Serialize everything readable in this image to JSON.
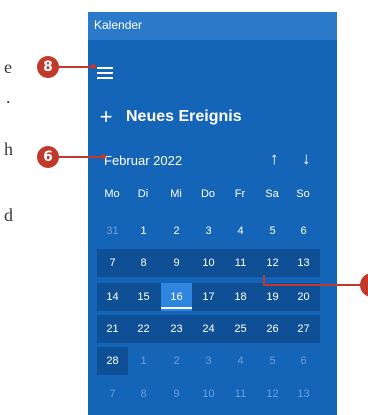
{
  "background_text": [
    "e",
    ".",
    "h",
    "d"
  ],
  "window": {
    "title": "Kalender"
  },
  "new_event": {
    "label": "Neues Ereignis"
  },
  "calendar": {
    "month": "Februar 2022",
    "weekdays": [
      "Mo",
      "Di",
      "Mi",
      "Do",
      "Fr",
      "Sa",
      "So"
    ],
    "weeks": [
      [
        {
          "d": "31",
          "m": true
        },
        {
          "d": "1"
        },
        {
          "d": "2"
        },
        {
          "d": "3"
        },
        {
          "d": "4"
        },
        {
          "d": "5"
        },
        {
          "d": "6"
        }
      ],
      [
        {
          "d": "7"
        },
        {
          "d": "8"
        },
        {
          "d": "9"
        },
        {
          "d": "10"
        },
        {
          "d": "11"
        },
        {
          "d": "12"
        },
        {
          "d": "13"
        }
      ],
      [
        {
          "d": "14"
        },
        {
          "d": "15"
        },
        {
          "d": "16",
          "today": true
        },
        {
          "d": "17"
        },
        {
          "d": "18"
        },
        {
          "d": "19"
        },
        {
          "d": "20"
        }
      ],
      [
        {
          "d": "21"
        },
        {
          "d": "22"
        },
        {
          "d": "23"
        },
        {
          "d": "24"
        },
        {
          "d": "25"
        },
        {
          "d": "26"
        },
        {
          "d": "27"
        }
      ],
      [
        {
          "d": "28"
        },
        {
          "d": "1",
          "m": true
        },
        {
          "d": "2",
          "m": true
        },
        {
          "d": "3",
          "m": true
        },
        {
          "d": "4",
          "m": true
        },
        {
          "d": "5",
          "m": true
        },
        {
          "d": "6",
          "m": true
        }
      ],
      [
        {
          "d": "7",
          "m": true
        },
        {
          "d": "8",
          "m": true
        },
        {
          "d": "9",
          "m": true
        },
        {
          "d": "10",
          "m": true
        },
        {
          "d": "11",
          "m": true
        },
        {
          "d": "12",
          "m": true
        },
        {
          "d": "13",
          "m": true
        }
      ]
    ]
  },
  "callouts": {
    "menu": "8",
    "month": "6"
  },
  "colors": {
    "panel": "#1464b8",
    "titlebar": "#2b79c9",
    "today": "#2f86e0",
    "callout": "#c0392b"
  }
}
